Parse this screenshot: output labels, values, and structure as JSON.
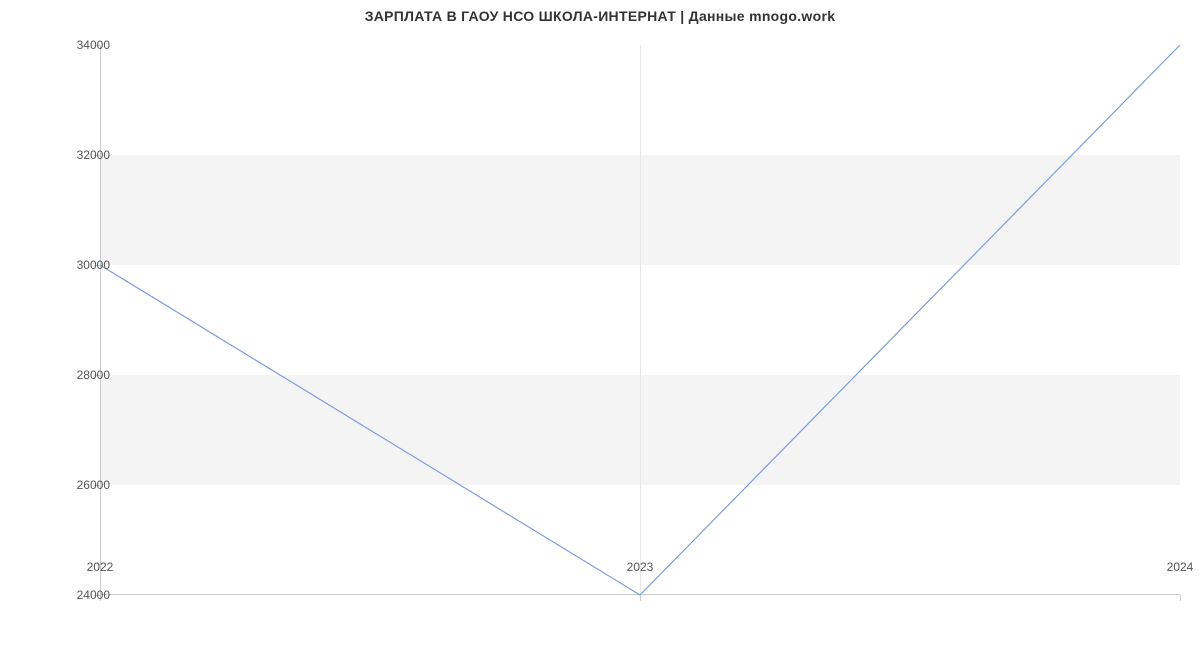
{
  "chart_data": {
    "type": "line",
    "title": "ЗАРПЛАТА В ГАОУ НСО ШКОЛА-ИНТЕРНАТ | Данные mnogo.work",
    "xlabel": "",
    "ylabel": "",
    "x_ticks": [
      "2022",
      "2023",
      "2024"
    ],
    "y_ticks": [
      24000,
      26000,
      28000,
      30000,
      32000,
      34000
    ],
    "ylim": [
      24000,
      34000
    ],
    "categories": [
      "2022",
      "2023",
      "2024"
    ],
    "values": [
      30000,
      24000,
      34000
    ],
    "bands": [
      {
        "from": 26000,
        "to": 28000
      },
      {
        "from": 30000,
        "to": 32000
      }
    ],
    "line_color": "#7b9fd8",
    "band_color": "#f4f4f4"
  }
}
